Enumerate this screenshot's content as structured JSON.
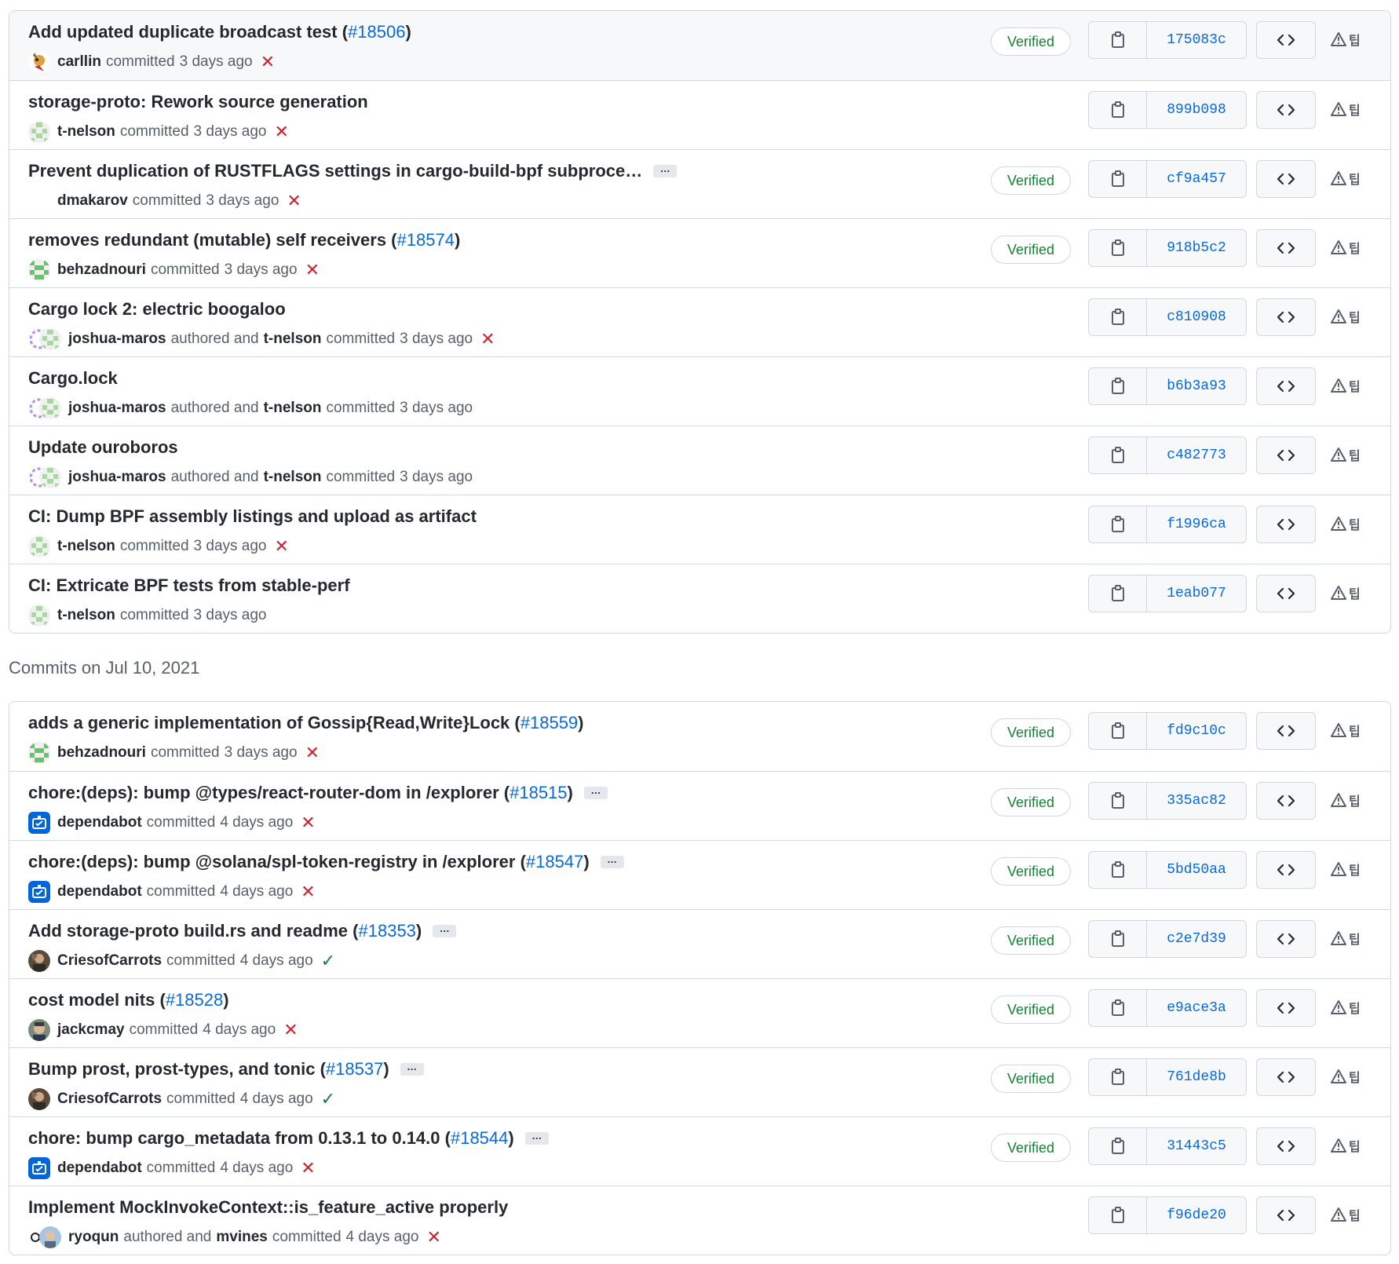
{
  "groups": [
    {
      "header": "",
      "commits": [
        {
          "title": "Add updated duplicate broadcast test",
          "pr": "#18506",
          "has_ellipsis": false,
          "avatars": [
            "carllin"
          ],
          "author": "carllin",
          "coauthor": "",
          "time": "3 days ago",
          "status": "fail",
          "verified": true,
          "sha": "175083c",
          "highlight": true
        },
        {
          "title": "storage-proto: Rework source generation",
          "pr": "",
          "has_ellipsis": false,
          "avatars": [
            "t-nelson"
          ],
          "author": "t-nelson",
          "coauthor": "",
          "time": "3 days ago",
          "status": "fail",
          "verified": false,
          "sha": "899b098",
          "highlight": false
        },
        {
          "title": "Prevent duplication of RUSTFLAGS settings in cargo-build-bpf subproce…",
          "pr": "",
          "has_ellipsis": true,
          "avatars": [
            "blank"
          ],
          "author": "dmakarov",
          "coauthor": "",
          "time": "3 days ago",
          "status": "fail",
          "verified": true,
          "sha": "cf9a457",
          "highlight": false
        },
        {
          "title": "removes redundant (mutable) self receivers",
          "pr": "#18574",
          "has_ellipsis": false,
          "avatars": [
            "behzadnouri"
          ],
          "author": "behzadnouri",
          "coauthor": "",
          "time": "3 days ago",
          "status": "fail",
          "verified": true,
          "sha": "918b5c2",
          "highlight": false
        },
        {
          "title": "Cargo lock 2: electric boogaloo",
          "pr": "",
          "has_ellipsis": false,
          "avatars": [
            "joshua-maros",
            "t-nelson"
          ],
          "author": "joshua-maros",
          "coauthor": "t-nelson",
          "time": "3 days ago",
          "status": "fail",
          "verified": false,
          "sha": "c810908",
          "highlight": false
        },
        {
          "title": "Cargo.lock",
          "pr": "",
          "has_ellipsis": false,
          "avatars": [
            "joshua-maros",
            "t-nelson"
          ],
          "author": "joshua-maros",
          "coauthor": "t-nelson",
          "time": "3 days ago",
          "status": "none",
          "verified": false,
          "sha": "b6b3a93",
          "highlight": false
        },
        {
          "title": "Update ouroboros",
          "pr": "",
          "has_ellipsis": false,
          "avatars": [
            "joshua-maros",
            "t-nelson"
          ],
          "author": "joshua-maros",
          "coauthor": "t-nelson",
          "time": "3 days ago",
          "status": "none",
          "verified": false,
          "sha": "c482773",
          "highlight": false
        },
        {
          "title": "CI: Dump BPF assembly listings and upload as artifact",
          "pr": "",
          "has_ellipsis": false,
          "avatars": [
            "t-nelson"
          ],
          "author": "t-nelson",
          "coauthor": "",
          "time": "3 days ago",
          "status": "fail",
          "verified": false,
          "sha": "f1996ca",
          "highlight": false
        },
        {
          "title": "CI: Extricate BPF tests from stable-perf",
          "pr": "",
          "has_ellipsis": false,
          "avatars": [
            "t-nelson"
          ],
          "author": "t-nelson",
          "coauthor": "",
          "time": "3 days ago",
          "status": "none",
          "verified": false,
          "sha": "1eab077",
          "highlight": false
        }
      ]
    },
    {
      "header": "Commits on Jul 10, 2021",
      "commits": [
        {
          "title": "adds a generic implementation of Gossip{Read,Write}Lock",
          "pr": "#18559",
          "has_ellipsis": false,
          "avatars": [
            "behzadnouri"
          ],
          "author": "behzadnouri",
          "coauthor": "",
          "time": "3 days ago",
          "status": "fail",
          "verified": true,
          "sha": "fd9c10c",
          "highlight": false
        },
        {
          "title": "chore:(deps): bump @types/react-router-dom in /explorer",
          "pr": "#18515",
          "has_ellipsis": true,
          "avatars": [
            "dependabot"
          ],
          "author": "dependabot",
          "coauthor": "",
          "time": "4 days ago",
          "status": "fail",
          "verified": true,
          "sha": "335ac82",
          "highlight": false
        },
        {
          "title": "chore:(deps): bump @solana/spl-token-registry in /explorer",
          "pr": "#18547",
          "has_ellipsis": true,
          "avatars": [
            "dependabot"
          ],
          "author": "dependabot",
          "coauthor": "",
          "time": "4 days ago",
          "status": "fail",
          "verified": true,
          "sha": "5bd50aa",
          "highlight": false
        },
        {
          "title": "Add storage-proto build.rs and readme",
          "pr": "#18353",
          "has_ellipsis": true,
          "avatars": [
            "CriesofCarrots"
          ],
          "author": "CriesofCarrots",
          "coauthor": "",
          "time": "4 days ago",
          "status": "ok",
          "verified": true,
          "sha": "c2e7d39",
          "highlight": false
        },
        {
          "title": "cost model nits",
          "pr": "#18528",
          "has_ellipsis": false,
          "avatars": [
            "jackcmay"
          ],
          "author": "jackcmay",
          "coauthor": "",
          "time": "4 days ago",
          "status": "fail",
          "verified": true,
          "sha": "e9ace3a",
          "highlight": false
        },
        {
          "title": "Bump prost, prost-types, and tonic",
          "pr": "#18537",
          "has_ellipsis": true,
          "avatars": [
            "CriesofCarrots"
          ],
          "author": "CriesofCarrots",
          "coauthor": "",
          "time": "4 days ago",
          "status": "ok",
          "verified": true,
          "sha": "761de8b",
          "highlight": false
        },
        {
          "title": "chore: bump cargo_metadata from 0.13.1 to 0.14.0",
          "pr": "#18544",
          "has_ellipsis": true,
          "avatars": [
            "dependabot"
          ],
          "author": "dependabot",
          "coauthor": "",
          "time": "4 days ago",
          "status": "fail",
          "verified": true,
          "sha": "31443c5",
          "highlight": false
        },
        {
          "title": "Implement MockInvokeContext::is_feature_active properly",
          "pr": "",
          "has_ellipsis": false,
          "avatars": [
            "ryoqun",
            "mvines"
          ],
          "author": "ryoqun",
          "coauthor": "mvines",
          "time": "4 days ago",
          "status": "fail",
          "verified": false,
          "sha": "f96de20",
          "highlight": false
        }
      ]
    }
  ],
  "labels": {
    "verified": "Verified",
    "committed": "committed",
    "authored_and": "authored and",
    "fail_glyph": "✕",
    "ok_glyph": "✓",
    "ellipsis": "…",
    "extra_glyph": "팁"
  },
  "icons": {
    "copy": "clipboard-icon",
    "browse": "code-icon",
    "extra": "warning-triangle-icon"
  },
  "colors": {
    "link": "#0969da",
    "verified": "#1a7f37",
    "fail": "#cf222e",
    "ok": "#1a7f37",
    "border": "#d0d7de"
  }
}
